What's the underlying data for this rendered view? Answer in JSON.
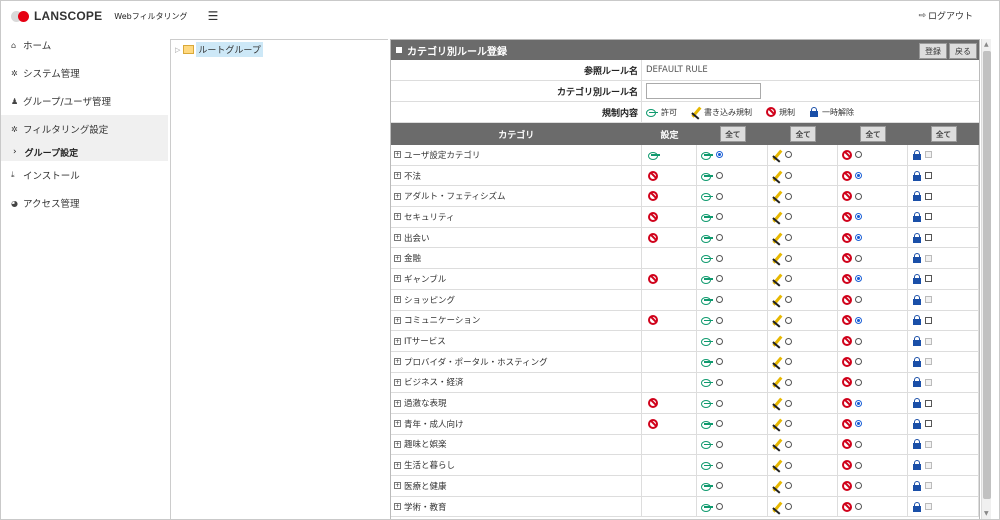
{
  "header": {
    "logo": "LANSCOPE",
    "product": "Webフィルタリング",
    "logout": "ログアウト"
  },
  "sidebar": {
    "items": [
      {
        "label": "ホーム",
        "icon": "home-icon"
      },
      {
        "label": "システム管理",
        "icon": "gear-icon"
      },
      {
        "label": "グループ/ユーザ管理",
        "icon": "users-icon"
      },
      {
        "label": "フィルタリング設定",
        "icon": "gears-icon"
      },
      {
        "label": "インストール",
        "icon": "download-icon"
      },
      {
        "label": "アクセス管理",
        "icon": "pie-chart-icon"
      }
    ],
    "sub_item": "グループ設定"
  },
  "tree": {
    "root": "ルートグループ"
  },
  "panel": {
    "title": "カテゴリ別ルール登録",
    "register_button": "登録",
    "back_button": "戻る",
    "ref_rule_label": "参照ルール名",
    "ref_rule_value": "DEFAULT RULE",
    "cat_rule_label": "カテゴリ別ルール名",
    "cat_rule_value": "",
    "restriction_label": "規制内容",
    "legend": {
      "allow": "許可",
      "write": "書き込み規制",
      "block": "規制",
      "unlock": "一時解除"
    }
  },
  "table": {
    "col_category": "カテゴリ",
    "col_setting": "設定",
    "all_label": "全て",
    "rows": [
      {
        "name": "ユーザ設定カテゴリ",
        "setting": "allow",
        "selected": "allow",
        "lock_enabled": false
      },
      {
        "name": "不法",
        "setting": "block",
        "selected": "block",
        "lock_enabled": true
      },
      {
        "name": "アダルト・フェティシズム",
        "setting": "block",
        "selected": "none",
        "lock_enabled": true
      },
      {
        "name": "セキュリティ",
        "setting": "block",
        "selected": "block",
        "lock_enabled": true
      },
      {
        "name": "出会い",
        "setting": "block",
        "selected": "block",
        "lock_enabled": true
      },
      {
        "name": "金融",
        "setting": "",
        "selected": "none",
        "lock_enabled": false
      },
      {
        "name": "ギャンブル",
        "setting": "block",
        "selected": "block",
        "lock_enabled": true
      },
      {
        "name": "ショッピング",
        "setting": "",
        "selected": "none",
        "lock_enabled": false
      },
      {
        "name": "コミュニケーション",
        "setting": "block",
        "selected": "block",
        "lock_enabled": true
      },
      {
        "name": "ITサービス",
        "setting": "",
        "selected": "none",
        "lock_enabled": false
      },
      {
        "name": "プロバイダ・ポータル・ホスティング",
        "setting": "",
        "selected": "none",
        "lock_enabled": false
      },
      {
        "name": "ビジネス・経済",
        "setting": "",
        "selected": "none",
        "lock_enabled": false
      },
      {
        "name": "過激な表現",
        "setting": "block",
        "selected": "block",
        "lock_enabled": true
      },
      {
        "name": "青年・成人向け",
        "setting": "block",
        "selected": "block",
        "lock_enabled": true
      },
      {
        "name": "趣味と娯楽",
        "setting": "",
        "selected": "none",
        "lock_enabled": false
      },
      {
        "name": "生活と暮らし",
        "setting": "",
        "selected": "none",
        "lock_enabled": false
      },
      {
        "name": "医療と健康",
        "setting": "",
        "selected": "none",
        "lock_enabled": false
      },
      {
        "name": "学術・教育",
        "setting": "",
        "selected": "none",
        "lock_enabled": false
      }
    ]
  }
}
